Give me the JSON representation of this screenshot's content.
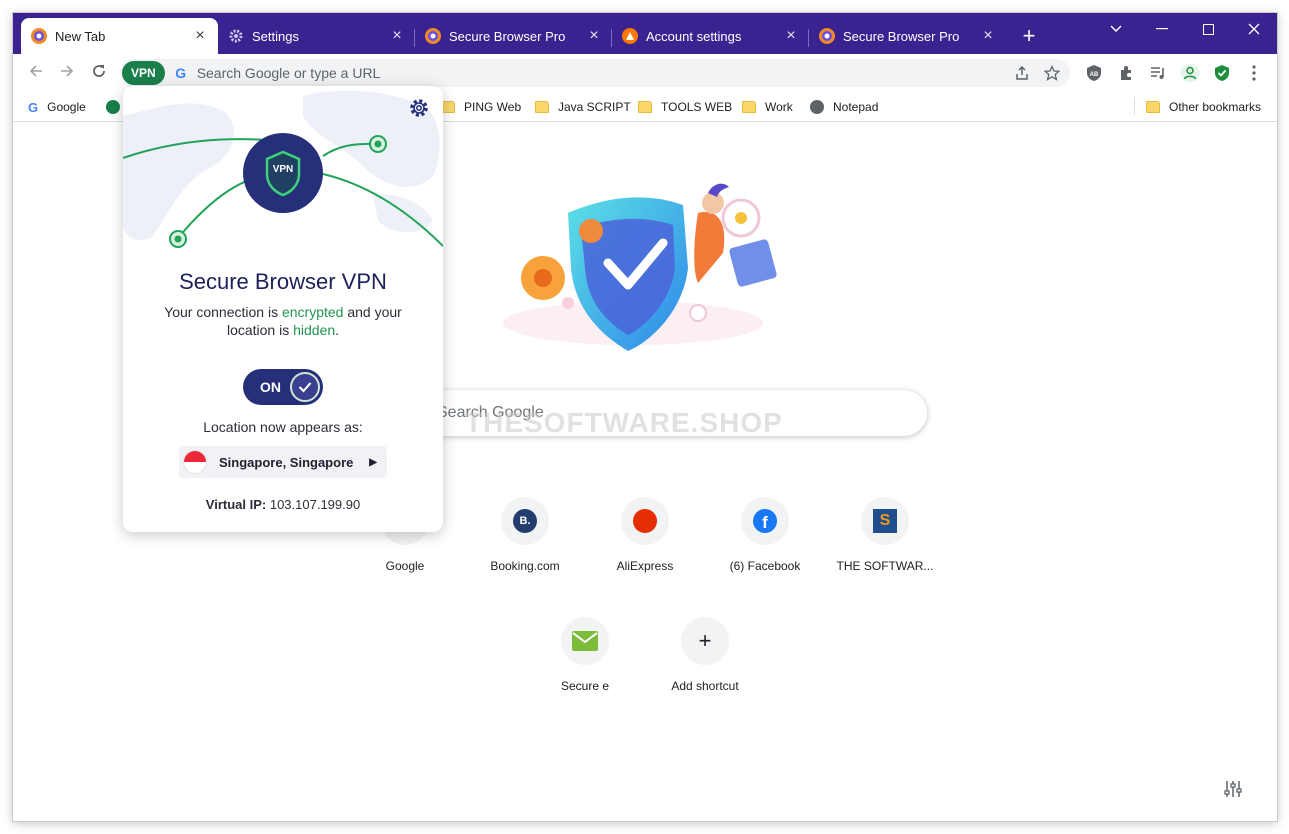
{
  "tabs": [
    {
      "title": "New Tab",
      "active": true,
      "icon": "secure-browser-icon"
    },
    {
      "title": "Settings",
      "active": false,
      "icon": "gear-icon"
    },
    {
      "title": "Secure Browser Pro",
      "active": false,
      "icon": "secure-browser-icon"
    },
    {
      "title": "Account settings",
      "active": false,
      "icon": "avast-icon"
    },
    {
      "title": "Secure Browser Pro",
      "active": false,
      "icon": "secure-browser-icon"
    }
  ],
  "toolbar": {
    "vpn_label": "VPN",
    "omnibox_placeholder": "Search Google or type a URL"
  },
  "bookmarks": [
    {
      "label": "Google",
      "icon": "google-icon"
    },
    {
      "label": "PING Web",
      "icon": "folder-icon"
    },
    {
      "label": "Java SCRIPT",
      "icon": "folder-icon"
    },
    {
      "label": "TOOLS WEB",
      "icon": "folder-icon"
    },
    {
      "label": "Work",
      "icon": "folder-icon"
    },
    {
      "label": "Notepad",
      "icon": "globe-icon"
    }
  ],
  "other_bookmarks": "Other bookmarks",
  "search": {
    "placeholder": "Search Google"
  },
  "watermark": "THESOFTWARE.SHOP",
  "shortcuts": [
    {
      "label": "Google"
    },
    {
      "label": "Booking.com",
      "letter": "B."
    },
    {
      "label": "AliExpress"
    },
    {
      "label": "(6) Facebook"
    },
    {
      "label": "THE SOFTWAR..."
    },
    {
      "label": "Secure e"
    },
    {
      "label": "Add shortcut"
    }
  ],
  "popup": {
    "badge": "VPN",
    "title": "Secure Browser VPN",
    "desc_1": "Your connection is ",
    "desc_encrypted": "encrypted",
    "desc_2": " and your location is ",
    "desc_hidden": "hidden",
    "desc_3": ".",
    "toggle_label": "ON",
    "location_label": "Location now appears as:",
    "location_value": "Singapore, Singapore",
    "virtual_ip_label": "Virtual IP:",
    "virtual_ip_value": "103.107.199.90"
  },
  "colors": {
    "tab_strip": "#3a2390",
    "vpn_green": "#1a7f4b",
    "popup_navy": "#26307a"
  }
}
